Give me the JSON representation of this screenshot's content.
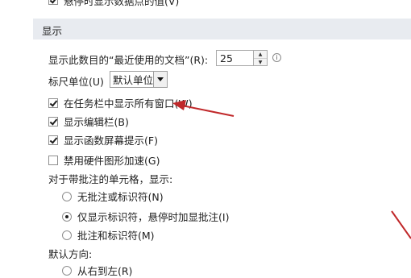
{
  "top_row": {
    "label": "悬停时显示数据点的值(V)",
    "checked": true
  },
  "section": {
    "title": "显示"
  },
  "recent_docs": {
    "label": "显示此数目的“最近使用的文档”(R):",
    "value": "25"
  },
  "ruler_unit": {
    "label": "标尺单位(U)",
    "selected": "默认单位"
  },
  "checkboxes": [
    {
      "label": "在任务栏中显示所有窗口(W)",
      "checked": true
    },
    {
      "label": "显示编辑栏(B)",
      "checked": true
    },
    {
      "label": "显示函数屏幕提示(F)",
      "checked": true
    },
    {
      "label": "禁用硬件图形加速(G)",
      "checked": false
    }
  ],
  "comments": {
    "label": "对于带批注的单元格，显示:",
    "options": [
      {
        "label": "无批注或标识符(N)",
        "selected": false
      },
      {
        "label": "仅显示标识符，悬停时加显批注(I)",
        "selected": true
      },
      {
        "label": "批注和标识符(M)",
        "selected": false
      }
    ]
  },
  "direction": {
    "label": "默认方向:",
    "options": [
      {
        "label": "从右到左(R)",
        "selected": false
      }
    ]
  },
  "colors": {
    "section_bg": "#e8ebf0",
    "annotation_arrow": "#c0282a"
  }
}
